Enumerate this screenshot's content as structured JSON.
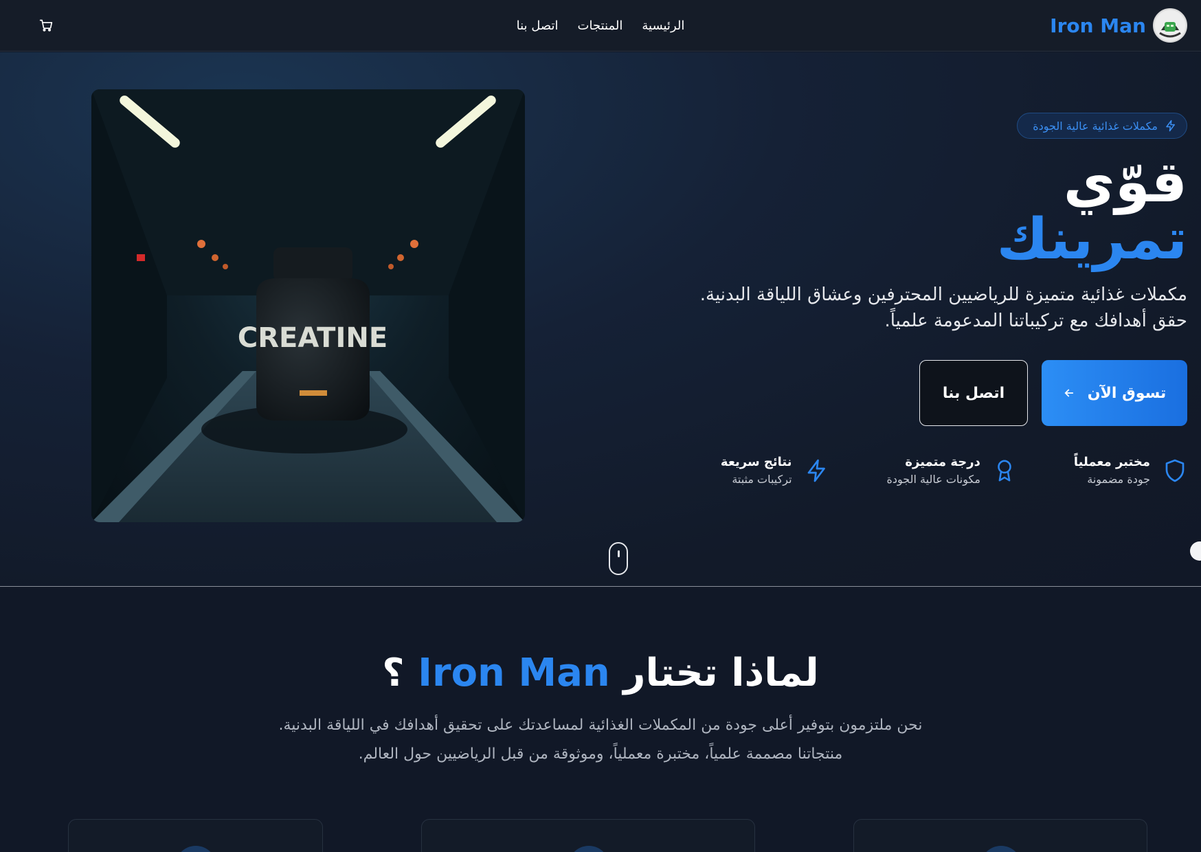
{
  "nav": {
    "brand": "Iron Man",
    "links": [
      "الرئيسية",
      "المنتجات",
      "اتصل بنا"
    ]
  },
  "hero": {
    "badge": "مكملات غذائية عالية الجودة",
    "title_line1": "قوّي",
    "title_line2": "تمرينك",
    "description_line1": "مكملات غذائية متميزة للرياضيين المحترفين وعشاق اللياقة البدنية.",
    "description_line2": "حقق أهدافك مع تركيباتنا المدعومة علمياً.",
    "primary_button": "تسوق الآن",
    "secondary_button": "اتصل بنا",
    "image_product_label": "CREATINE",
    "features": [
      {
        "title": "مختبر معملياً",
        "subtitle": "جودة مضمونة",
        "icon": "shield-icon"
      },
      {
        "title": "درجة متميزة",
        "subtitle": "مكونات عالية الجودة",
        "icon": "award-icon"
      },
      {
        "title": "نتائج سريعة",
        "subtitle": "تركيبات مثبتة",
        "icon": "lightning-icon"
      }
    ]
  },
  "why": {
    "title_prefix": "لماذا تختار",
    "title_brand": "Iron Man",
    "title_suffix": "؟",
    "description_line1": "نحن ملتزمون بتوفير أعلى جودة من المكملات الغذائية لمساعدتك على تحقيق أهدافك في اللياقة البدنية.",
    "description_line2": "منتجاتنا مصممة علمياً، مختبرة معملياً، وموثوقة من قبل الرياضيين حول العالم."
  },
  "colors": {
    "accent": "#2b86f0",
    "background": "#111827",
    "navbar": "#151c28"
  }
}
